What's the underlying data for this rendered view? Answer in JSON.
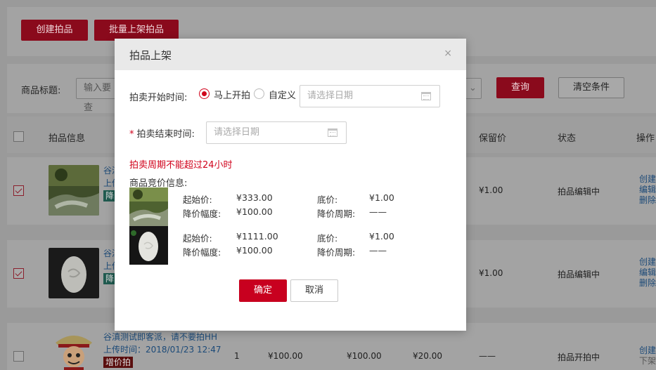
{
  "toolbar": {
    "create_label": "创建拍品",
    "batch_label": "批量上架拍品"
  },
  "filter": {
    "title_label": "商品标题:",
    "title_placeholder": "输入要查",
    "query_label": "查询",
    "clear_label": "清空条件"
  },
  "table": {
    "headers": {
      "info": "拍品信息",
      "reserve": "保留价",
      "status": "状态",
      "ops": "操作"
    },
    "rows": [
      {
        "title": "谷滇",
        "upload": "上传",
        "tag": "降",
        "reserve": "¥1.00",
        "status": "拍品编辑中",
        "ops": [
          "创建",
          "编辑",
          "删除"
        ],
        "checked": true
      },
      {
        "title": "谷滇",
        "upload": "上传",
        "tag": "降",
        "reserve": "¥1.00",
        "status": "拍品编辑中",
        "ops": [
          "创建",
          "编辑",
          "删除"
        ],
        "checked": true
      },
      {
        "title": "谷滇测试即客派，请不要拍HH",
        "upload": "上传时间：2018/01/23 12:47",
        "tag": "增价拍",
        "qty": "1",
        "price1": "¥100.00",
        "price2": "¥100.00",
        "price3": "¥20.00",
        "dash": "——",
        "status": "拍品开拍中",
        "ops": [
          "创建",
          "下架"
        ],
        "checked": false
      }
    ]
  },
  "modal": {
    "title": "拍品上架",
    "close": "×",
    "start_label": "拍卖开始时间:",
    "radio_now": "马上开拍",
    "radio_custom": "自定义",
    "date_placeholder": "请选择日期",
    "required_mark": "*",
    "end_label": "拍卖结束时间:",
    "end_placeholder": "请选择日期",
    "warning": "拍卖周期不能超过24小时",
    "bid_info_label": "商品竞价信息:",
    "items": [
      {
        "start_price_label": "起始价:",
        "start_price": "¥333.00",
        "floor_label": "底价:",
        "floor": "¥1.00",
        "drop_label": "降价幅度:",
        "drop": "¥100.00",
        "period_label": "降价周期:",
        "period": "——"
      },
      {
        "start_price_label": "起始价:",
        "start_price": "¥1111.00",
        "floor_label": "底价:",
        "floor": "¥1.00",
        "drop_label": "降价幅度:",
        "drop": "¥100.00",
        "period_label": "降价周期:",
        "period": "——"
      }
    ],
    "confirm_label": "确定",
    "cancel_label": "取消"
  },
  "colors": {
    "primary": "#c8001f",
    "overlay": "#8e8e8e",
    "link": "#1c4a78"
  }
}
